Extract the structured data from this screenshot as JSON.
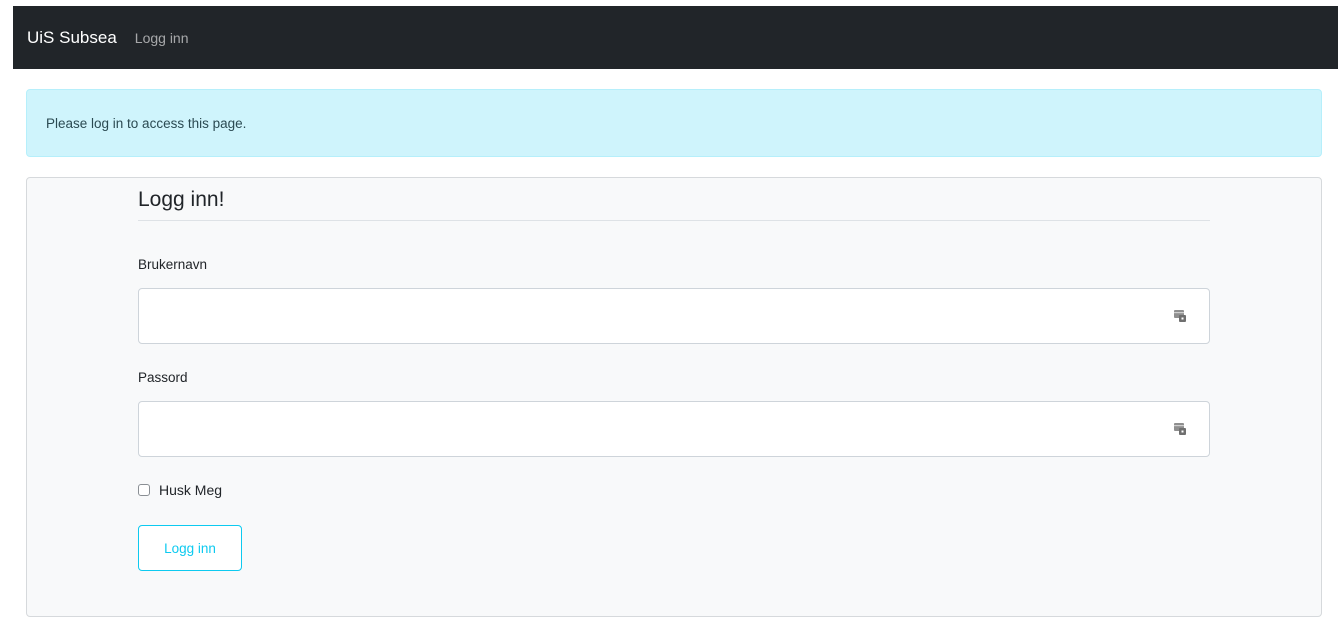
{
  "navbar": {
    "brand": "UiS Subsea",
    "link": "Logg inn"
  },
  "alert": {
    "message": "Please log in to access this page."
  },
  "form": {
    "legend": "Logg inn!",
    "username": {
      "label": "Brukernavn",
      "value": "",
      "icon": "key-icon"
    },
    "password": {
      "label": "Passord",
      "value": "",
      "icon": "key-icon"
    },
    "remember": {
      "label": "Husk Meg",
      "checked": false
    },
    "submit_label": "Logg inn",
    "accent_color": "#0dcaf0"
  }
}
